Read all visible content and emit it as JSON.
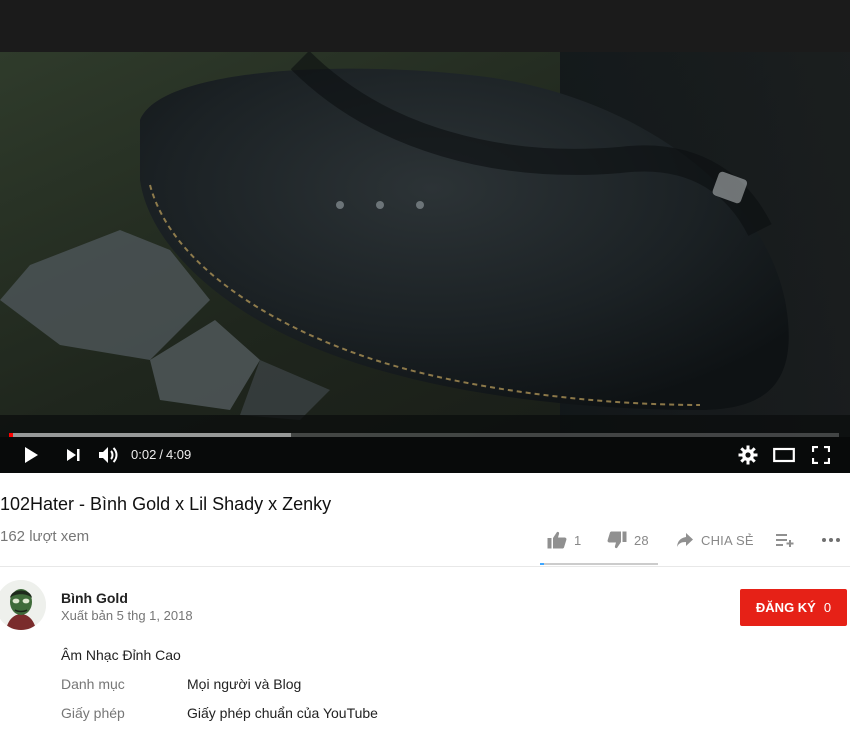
{
  "player": {
    "current_time": "0:02",
    "time_separator": "/",
    "duration": "4:09",
    "progress_played_fraction": 0.0008,
    "progress_buffered_fraction": 0.34,
    "icons": [
      "play-icon",
      "next-icon",
      "volume-icon",
      "settings-icon",
      "theater-mode-icon",
      "fullscreen-icon"
    ]
  },
  "video": {
    "title": "102Hater - Bình Gold x Lil Shady x Zenky",
    "views": "162 lượt xem"
  },
  "actions": {
    "like_count": "1",
    "dislike_count": "28",
    "share_label": "CHIA SẺ",
    "like_ratio": 0.034
  },
  "channel": {
    "name": "Bình Gold",
    "published": "Xuất bản 5 thg 1, 2018",
    "subscribe_label": "ĐĂNG KÝ",
    "subscriber_count": "0"
  },
  "description": {
    "text": "Âm Nhạc Đỉnh Cao",
    "category_label": "Danh mục",
    "category_value": "Mọi người và Blog",
    "license_label": "Giấy phép",
    "license_value": "Giấy phép chuẩn của YouTube"
  },
  "colors": {
    "accent": "#ff0000",
    "subscribe_bg": "#e62117",
    "sentiment_like": "#3ea6ff"
  }
}
